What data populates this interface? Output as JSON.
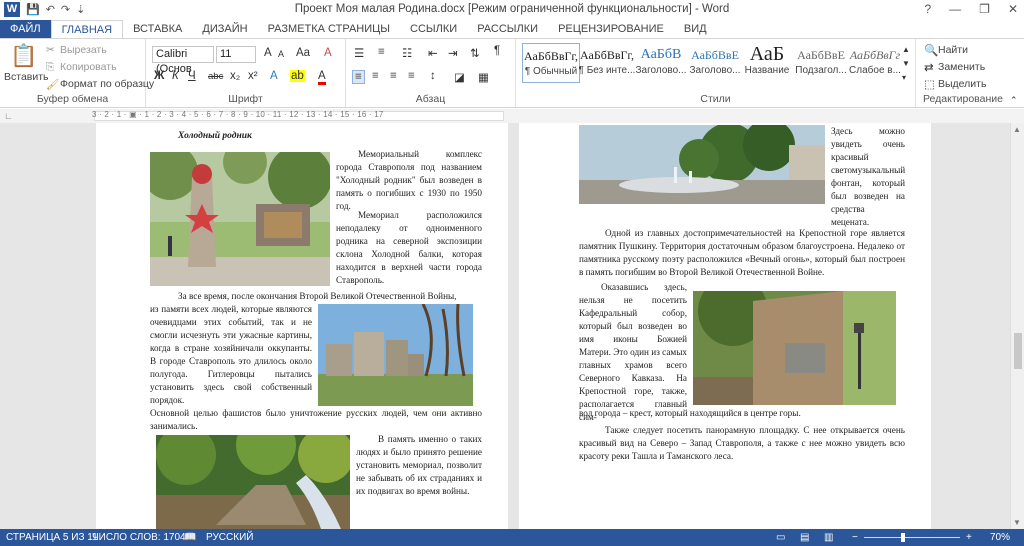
{
  "window": {
    "title": "Проект Моя малая Родина.docx [Режим ограниченной функциональности] - Word",
    "app_icon": "W",
    "help": "?",
    "minimize": "—",
    "restore": "❐",
    "close": "✕"
  },
  "qat": {
    "save": "💾",
    "undo": "↶",
    "redo": "↷",
    "more": "⇣"
  },
  "tabs": [
    {
      "label": "ФАЙЛ"
    },
    {
      "label": "ГЛАВНАЯ"
    },
    {
      "label": "ВСТАВКА"
    },
    {
      "label": "ДИЗАЙН"
    },
    {
      "label": "РАЗМЕТКА СТРАНИЦЫ"
    },
    {
      "label": "ССЫЛКИ"
    },
    {
      "label": "РАССЫЛКИ"
    },
    {
      "label": "РЕЦЕНЗИРОВАНИЕ"
    },
    {
      "label": "ВИД"
    }
  ],
  "ribbon": {
    "clipboard": {
      "paste": "Вставить",
      "cut": "Вырезать",
      "copy": "Копировать",
      "format_painter": "Формат по образцу",
      "label": "Буфер обмена"
    },
    "font": {
      "font_name": "Calibri (Основ",
      "font_size": "11",
      "bold": "Ж",
      "italic": "К",
      "underline": "Ч",
      "strike": "abc",
      "sub": "x₂",
      "sup": "x²",
      "grow": "A",
      "shrink": "A",
      "case": "Aa",
      "clear": "A",
      "effects": "A",
      "highlight": "ab",
      "color": "A",
      "label": "Шрифт"
    },
    "paragraph": {
      "label": "Абзац",
      "pilcrow": "¶"
    },
    "styles": {
      "items": [
        {
          "sample": "АаБбВвГг,",
          "name": "¶ Обычный"
        },
        {
          "sample": "АаБбВвГг,",
          "name": "¶ Без инте..."
        },
        {
          "sample": "АаБбВ",
          "name": "Заголово..."
        },
        {
          "sample": "АаБбВвЕ",
          "name": "Заголово..."
        },
        {
          "sample": "АаБ",
          "name": "Название"
        },
        {
          "sample": "АаБбВвЕ",
          "name": "Подзагол..."
        },
        {
          "sample": "АаБбВвГг",
          "name": "Слабое в..."
        }
      ],
      "label": "Стили"
    },
    "editing": {
      "find": "Найти",
      "replace": "Заменить",
      "select": "Выделить",
      "label": "Редактирование"
    }
  },
  "ruler": {
    "marks": "3 · 2 · 1 · ▣ · 1 · 2 · 3 · 4 · 5 · 6 · 7 · 8 · 9 · 10 · 11 · 12 · 13 · 14 · 15 · 16 · 17"
  },
  "page1": {
    "heading": "Холодный родник",
    "p1": "Мемориальный комплекс города Ставрополя под названием \"Холодный родник\" был возведен в память о погибших с 1930 по 1950 год.",
    "p2": "Мемориал расположился неподалеку от одноименного родника на северной экспозиции склона Холодной балки, которая находится в верхней части города Ставрополь.",
    "p3a": "За все время, после окончания Второй Великой Отечественной Войны,",
    "p3b": "из памяти всех людей, которые являются очевидцами этих событий, так и не смогли исчезнуть эти ужасные картины, когда в стране хозяйничали оккупанты. В городе Ставрополь это длилось около полугода. Гитлеровцы пытались установить здесь свой собственный порядок.",
    "p3c": "Основной целью фашистов было уничтожение русских людей, чем они активно занимались.",
    "p4": "В память именно о таких людях и было принято решение установить мемориал, позволит не забывать об их страданиях и их подвигах во время войны."
  },
  "page2": {
    "p0": "Здесь можно увидеть очень красивый светомузыкальный фонтан, который был возведен на средства мецената.",
    "p1": "Одной из главных достопримечательностей на Крепостной горе является памятник Пушкину. Территория достаточным образом благоустроена. Недалеко от памятника русскому поэту расположился «Вечный огонь», который был построен в память погибшим во Второй Великой Отечественной Войне.",
    "p2a": "Оказавшись здесь, нельзя не посетить Кафедральный собор, который был возведен во имя иконы Божией Матери. Это один из самых главных храмов всего Северного Кавказа. На Крепостной горе, также, располагается главный сим-",
    "p2b": "вол города – крест, который находящийся в центре горы.",
    "p3": "Также следует посетить панорамную площадку. С нее открывается очень красивый вид на Северо – Запад Ставрополя, а также с нее можно увидеть всю красоту реки Ташла и Таманского леса."
  },
  "status": {
    "page": "СТРАНИЦА 5 ИЗ 11",
    "words": "ЧИСЛО СЛОВ: 1704",
    "lang": "РУССКИЙ",
    "zoom": "70%",
    "zoom_level": 0.7
  }
}
